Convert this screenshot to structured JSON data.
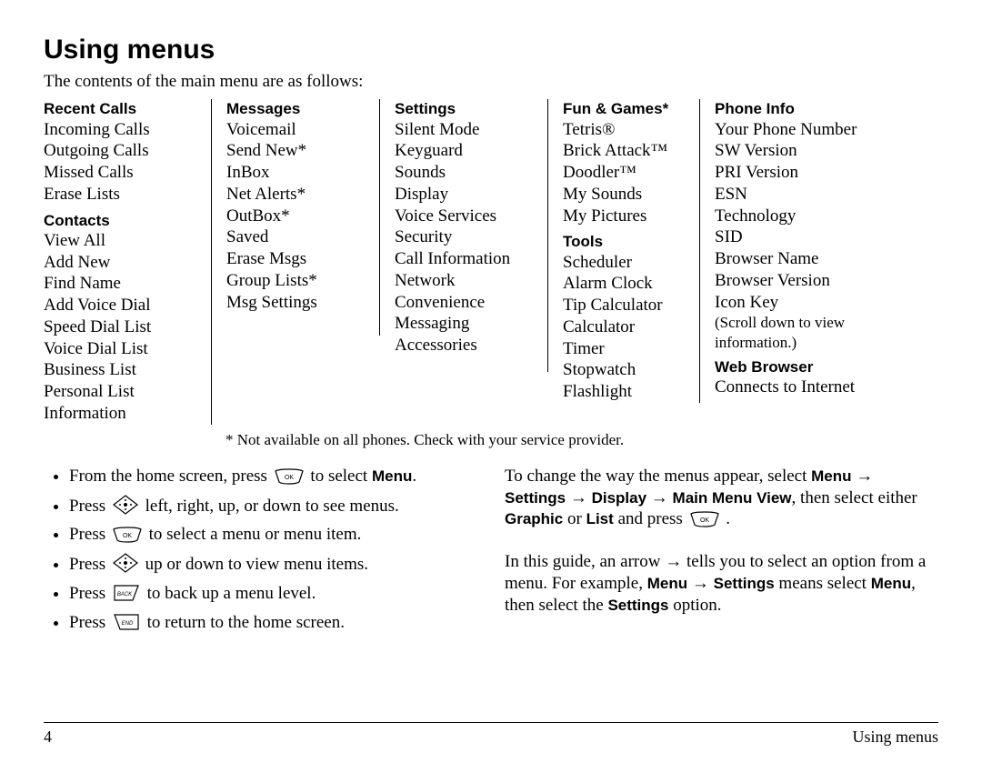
{
  "title": "Using menus",
  "intro": "The contents of the main menu are as follows:",
  "columns": {
    "col1": {
      "g1": {
        "head": "Recent Calls",
        "items": [
          "Incoming Calls",
          "Outgoing Calls",
          "Missed Calls",
          "Erase Lists"
        ]
      },
      "g2": {
        "head": "Contacts",
        "items": [
          "View All",
          "Add New",
          "Find Name",
          "Add Voice Dial",
          "Speed Dial List",
          "Voice Dial List",
          "Business List",
          "Personal List",
          "Information"
        ]
      }
    },
    "col2": {
      "g1": {
        "head": "Messages",
        "items": [
          "Voicemail",
          "Send New*",
          "InBox",
          "Net Alerts*",
          "OutBox*",
          "Saved",
          "Erase Msgs",
          "Group Lists*",
          "Msg Settings"
        ]
      }
    },
    "col3": {
      "g1": {
        "head": "Settings",
        "items": [
          "Silent Mode",
          "Keyguard",
          "Sounds",
          "Display",
          "Voice Services",
          "Security",
          "Call Information",
          "Network",
          "Convenience",
          "Messaging",
          "Accessories"
        ]
      }
    },
    "col4": {
      "g1": {
        "head": "Fun & Games*",
        "items": [
          "Tetris®",
          "Brick Attack™",
          "Doodler™",
          "My Sounds",
          "My Pictures"
        ]
      },
      "g2": {
        "head": "Tools",
        "items": [
          "Scheduler",
          "Alarm Clock",
          "Tip Calculator",
          "Calculator",
          "Timer",
          "Stopwatch",
          "Flashlight"
        ]
      }
    },
    "col5": {
      "g1": {
        "head": "Phone Info",
        "items": [
          "Your Phone Number",
          "SW Version",
          "PRI Version",
          "ESN",
          "Technology",
          "SID",
          "Browser Name",
          "Browser Version",
          "Icon Key"
        ],
        "scroll_note": "(Scroll down to view information.)"
      },
      "g2": {
        "head": "Web Browser",
        "items": [
          "Connects to Internet"
        ]
      }
    }
  },
  "footnote": "* Not available on all phones. Check with your service provider.",
  "left_instructions": {
    "li0_a": "From the home screen, press ",
    "li0_b": " to select ",
    "li0_c": "Menu",
    "li0_d": ".",
    "li1_a": "Press ",
    "li1_b": " left, right, up, or down to see menus.",
    "li2_a": "Press ",
    "li2_b": " to select a menu or menu item.",
    "li3_a": "Press ",
    "li3_b": " up or down to view menu items.",
    "li4_a": "Press ",
    "li4_b": " to back up a menu level.",
    "li5_a": "Press ",
    "li5_b": " to return to the home screen."
  },
  "right_instructions": {
    "p1_a": "To change the way the menus appear, select ",
    "p1_menu": "Menu",
    "arrow": " → ",
    "p1_settings": "Settings",
    "p1_display": "Display",
    "p1_mainmenu": "Main Menu View",
    "p1_then": ", then select either ",
    "p1_graphic": "Graphic",
    "p1_or": " or ",
    "p1_list": "List",
    "p1_and": " and press ",
    "p1_period": " .",
    "p2_a": "In this guide, an arrow → tells you to select an option from a menu. For example, ",
    "p2_menu": "Menu",
    "p2_settings": "Settings",
    "p2_means": " means select ",
    "p2_menu2": "Menu",
    "p2_then": ", then select the ",
    "p2_settings2": "Settings",
    "p2_option": " option."
  },
  "footer": {
    "page": "4",
    "section": "Using menus"
  }
}
